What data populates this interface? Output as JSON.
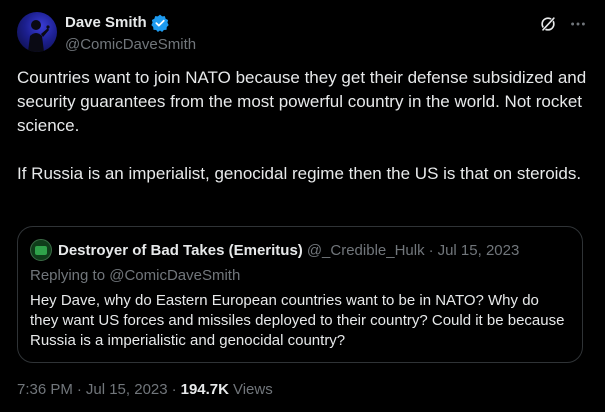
{
  "author": {
    "display_name": "Dave Smith",
    "handle": "@ComicDaveSmith",
    "verified": true
  },
  "header_icons": [
    "grok-icon",
    "more-icon"
  ],
  "tweet": {
    "text": "Countries want to join NATO because they get their defense subsidized and security guarantees from the most powerful country in the world. Not rocket science.\n\nIf Russia is an imperialist, genocidal regime then the US is that on steroids."
  },
  "quoted_tweet": {
    "display_name": "Destroyer of Bad Takes (Emeritus)",
    "handle": "@_Credible_Hulk",
    "separator": "·",
    "date": "Jul 15, 2023",
    "replying_prefix": "Replying to",
    "replying_to": "@ComicDaveSmith",
    "text": "Hey Dave, why do Eastern European countries want to be in NATO? Why do they want US forces and missiles deployed to their country? Could it be because Russia is a imperialistic and genocidal country?"
  },
  "meta": {
    "time": "7:36 PM",
    "separator": "·",
    "date": "Jul 15, 2023",
    "separator2": "·",
    "views_count": "194.7K",
    "views_label": "Views"
  },
  "colors": {
    "background": "#000000",
    "primary_text": "#e7e9ea",
    "secondary_text": "#71767b",
    "border": "#2f3336",
    "verified_badge": "#1d9bf0"
  }
}
